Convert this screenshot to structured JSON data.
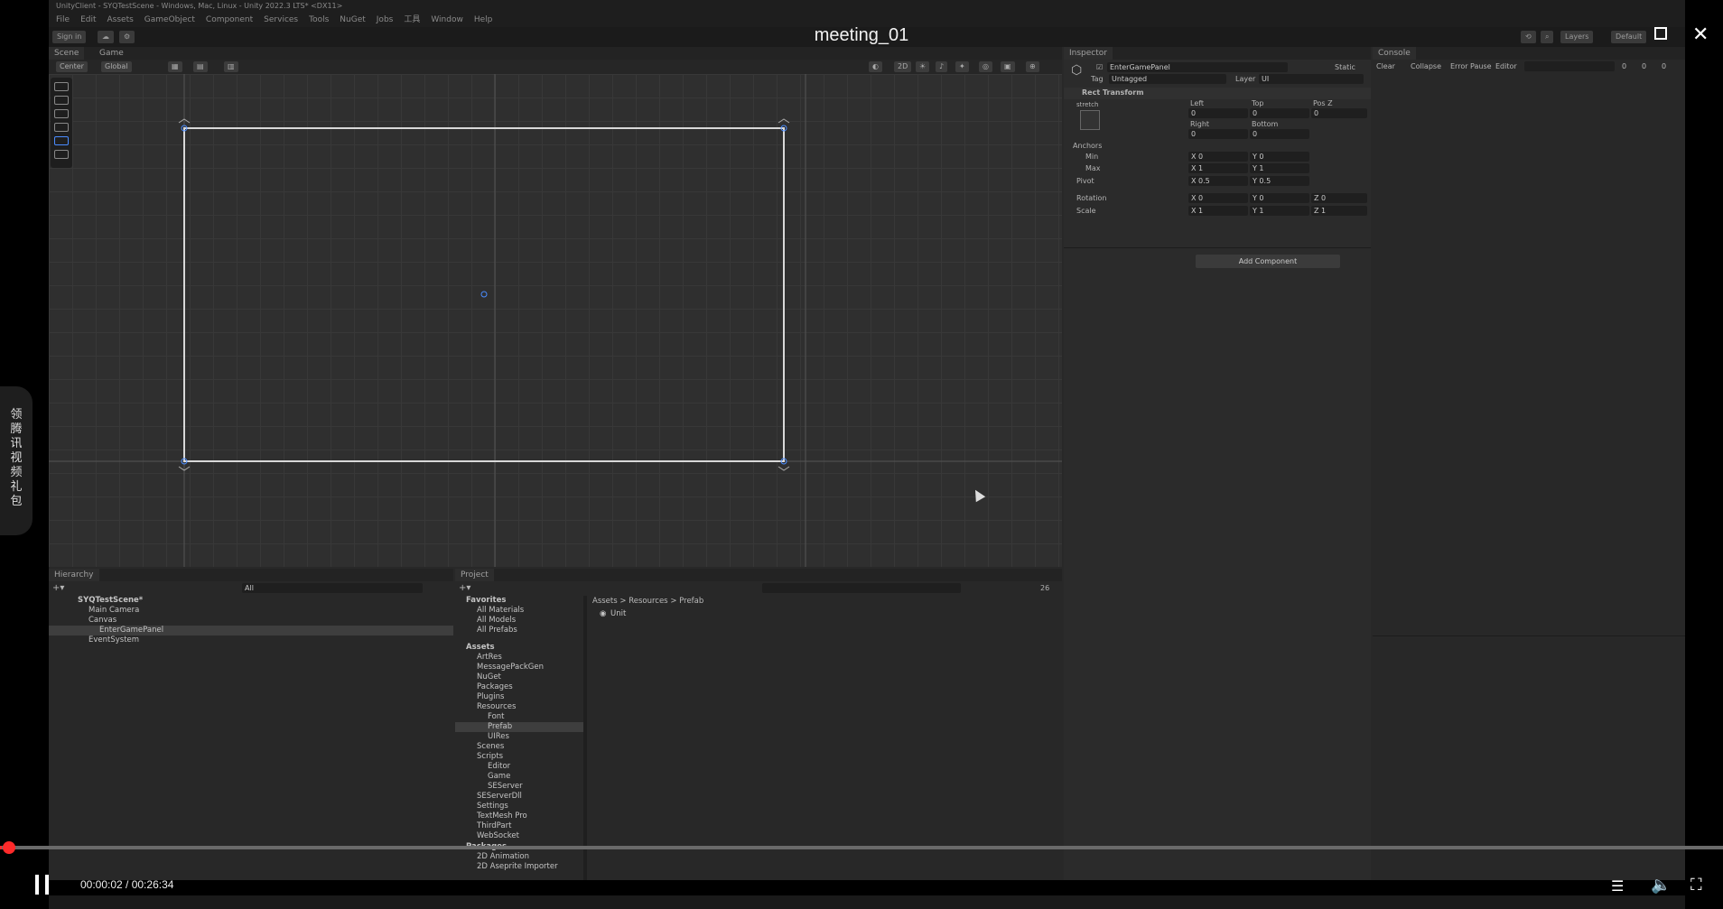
{
  "video": {
    "title": "meeting_01",
    "timecode": "00:00:02 / 00:26:34",
    "progress_fraction": 0.0013,
    "side_tab_text": [
      "领",
      "腾",
      "讯",
      "视",
      "频",
      "礼",
      "包"
    ]
  },
  "unity": {
    "window_title": "UnityClient - SYQTestScene - Windows, Mac, Linux - Unity 2022.3 LTS* <DX11>",
    "menu": [
      "File",
      "Edit",
      "Assets",
      "GameObject",
      "Component",
      "Services",
      "Tools",
      "NuGet",
      "Jobs",
      "工具",
      "Window",
      "Help"
    ],
    "toolbar": {
      "sign_in": "Sign in",
      "layers": "Layers",
      "layout": "Default"
    },
    "scene": {
      "tabs": [
        "Scene",
        "Game"
      ],
      "pivot": "Center",
      "space": "Global"
    },
    "inspector": {
      "tab": "Inspector",
      "object_name": "EnterGamePanel",
      "static_label": "Static",
      "tag_label": "Tag",
      "tag_value": "Untagged",
      "layer_label": "Layer",
      "layer_value": "UI",
      "component": "Rect Transform",
      "stretch": "stretch",
      "left_label": "Left",
      "left": "0",
      "top_label": "Top",
      "top": "0",
      "posz_label": "Pos Z",
      "posz": "0",
      "right_label": "Right",
      "right": "0",
      "bottom_label": "Bottom",
      "bottom": "0",
      "anchors_label": "Anchors",
      "min_label": "Min",
      "min_x": "X 0",
      "min_y": "Y 0",
      "max_label": "Max",
      "max_x": "X 1",
      "max_y": "Y 1",
      "pivot_label": "Pivot",
      "pivot_x": "X 0.5",
      "pivot_y": "Y 0.5",
      "rotation_label": "Rotation",
      "rot_x": "X 0",
      "rot_y": "Y 0",
      "rot_z": "Z 0",
      "scale_label": "Scale",
      "scale_x": "X 1",
      "scale_y": "Y 1",
      "scale_z": "Z 1",
      "add_component": "Add Component"
    },
    "console": {
      "tab": "Console",
      "clear": "Clear",
      "collapse": "Collapse",
      "error_pause": "Error Pause",
      "editor": "Editor",
      "counts": [
        "0",
        "0",
        "0"
      ]
    },
    "hierarchy": {
      "tab": "Hierarchy",
      "search_placeholder": "All",
      "items": [
        "SYQTestScene*",
        "Main Camera",
        "Canvas",
        "EnterGamePanel",
        "EventSystem"
      ]
    },
    "project": {
      "tab": "Project",
      "count": "26",
      "favorites_label": "Favorites",
      "favorites": [
        "All Materials",
        "All Models",
        "All Prefabs"
      ],
      "assets_label": "Assets",
      "assets": [
        "ArtRes",
        "MessagePackGen",
        "NuGet",
        "Packages",
        "Plugins",
        "Resources",
        "Font",
        "Prefab",
        "UIRes",
        "Scenes",
        "Scripts",
        "Editor",
        "Game",
        "SEServer",
        "SEServerDll",
        "Settings",
        "TextMesh Pro",
        "ThirdPart",
        "WebSocket"
      ],
      "packages_label": "Packages",
      "packages": [
        "2D Animation",
        "2D Aseprite Importer"
      ],
      "breadcrumb": [
        "Assets",
        "Resources",
        "Prefab"
      ],
      "content": [
        "Unit"
      ]
    }
  },
  "colors": {
    "accent_red": "#ff2a2a",
    "panel": "#282828",
    "selection": "#3e3e3e"
  }
}
